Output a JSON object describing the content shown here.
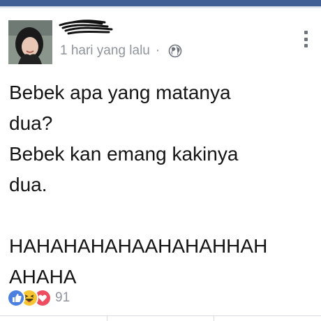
{
  "post": {
    "timestamp": "1 hari yang lalu",
    "separator": "·",
    "privacy_icon": "globe-icon",
    "menu_icon": "more-vertical-icon",
    "text": "Bebek apa yang matanya\ndua?\nBebek kan emang kakinya\ndua.\n\nHAHAHAHAHAAHAHAHHAH\nAHAHA"
  },
  "reactions": {
    "icons": [
      "like-icon",
      "haha-icon",
      "love-icon"
    ],
    "count": "91"
  },
  "colors": {
    "topbar": "#3f5f95",
    "meta_text": "#8f949c",
    "like": "#4b7fe0",
    "haha": "#f7c531",
    "love": "#ee4d5f"
  }
}
